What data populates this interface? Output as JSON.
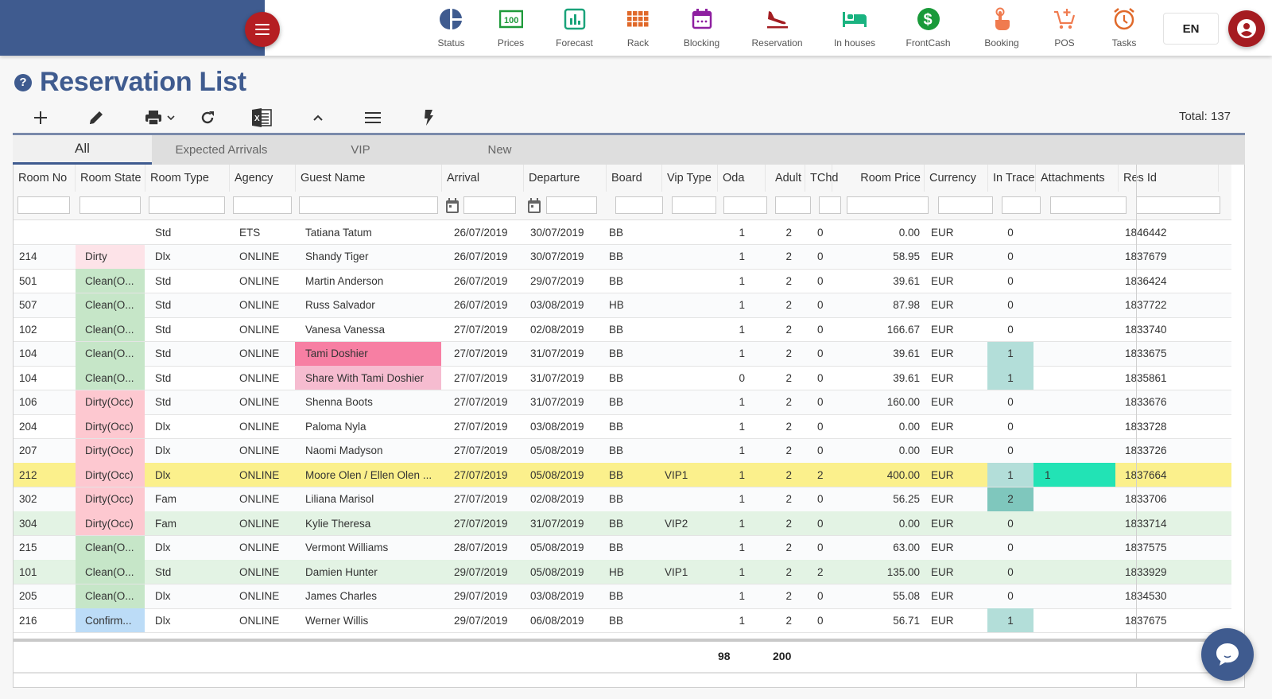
{
  "header": {
    "nav": [
      {
        "key": "status",
        "label": "Status",
        "icon": "pie-chart-icon",
        "color": "#3f5b8f"
      },
      {
        "key": "prices",
        "label": "Prices",
        "icon": "money-bill-icon",
        "color": "#1e9a3a"
      },
      {
        "key": "forecast",
        "label": "Forecast",
        "icon": "bar-chart-icon",
        "color": "#1aa37a"
      },
      {
        "key": "rack",
        "label": "Rack",
        "icon": "grid-icon",
        "color": "#e0692a"
      },
      {
        "key": "blocking",
        "label": "Blocking",
        "icon": "calendar-icon",
        "color": "#8e1fa0"
      },
      {
        "key": "reservation",
        "label": "Reservation",
        "icon": "plane-landing-icon",
        "color": "#a31d22"
      },
      {
        "key": "in_houses",
        "label": "In houses",
        "icon": "bed-icon",
        "color": "#1ab380"
      },
      {
        "key": "frontcash",
        "label": "FrontCash",
        "icon": "dollar-circle-icon",
        "color": "#1a9a3a"
      },
      {
        "key": "booking",
        "label": "Booking",
        "icon": "hand-pointer-icon",
        "color": "#f07b4f"
      },
      {
        "key": "pos",
        "label": "POS",
        "icon": "cart-plus-icon",
        "color": "#f07b4f"
      },
      {
        "key": "tasks",
        "label": "Tasks",
        "icon": "alarm-clock-icon",
        "color": "#e0692a"
      }
    ],
    "language": "EN",
    "brand_color": "#3f5b8f",
    "accent_color": "#b51e22"
  },
  "page": {
    "title": "Reservation List",
    "total_label": "Total: 137"
  },
  "toolbar": {
    "icons": [
      "add-icon",
      "edit-icon",
      "print-icon",
      "refresh-icon",
      "excel-export-icon",
      "collapse-icon",
      "menu-icon",
      "flash-icon"
    ]
  },
  "tabs": [
    {
      "label": "All",
      "active": true
    },
    {
      "label": "Expected Arrivals",
      "active": false
    },
    {
      "label": "VIP",
      "active": false
    },
    {
      "label": "New",
      "active": false
    }
  ],
  "columns": [
    "Room No",
    "Room State",
    "Room Type",
    "Agency",
    "Guest Name",
    "Arrival",
    "Departure",
    "Board",
    "Vip Type",
    "Oda",
    "Adult",
    "TChd",
    "Room Price",
    "Currency",
    "In Trace",
    "Attachments",
    "Res Id"
  ],
  "rows": [
    {
      "room": "",
      "state": "",
      "state_kind": "",
      "type": "Std",
      "agency": "ETS",
      "guest": "Tatiana Tatum",
      "guest_kind": "",
      "arrival": "26/07/2019",
      "departure": "30/07/2019",
      "board": "BB",
      "vip": "",
      "oda": "1",
      "adult": "2",
      "tchd": "0",
      "price": "0.00",
      "currency": "EUR",
      "trace": "0",
      "trace_kind": "",
      "attach": "",
      "resid": "1846442",
      "row_kind": ""
    },
    {
      "room": "214",
      "state": "Dirty",
      "state_kind": "dirty-light",
      "type": "Dlx",
      "agency": "ONLINE",
      "guest": "Shandy Tiger",
      "guest_kind": "",
      "arrival": "26/07/2019",
      "departure": "30/07/2019",
      "board": "BB",
      "vip": "",
      "oda": "1",
      "adult": "2",
      "tchd": "0",
      "price": "58.95",
      "currency": "EUR",
      "trace": "0",
      "trace_kind": "",
      "attach": "",
      "resid": "1837679",
      "row_kind": "alt"
    },
    {
      "room": "501",
      "state": "Clean(O...",
      "state_kind": "clean",
      "type": "Std",
      "agency": "ONLINE",
      "guest": "Martin Anderson",
      "guest_kind": "",
      "arrival": "26/07/2019",
      "departure": "29/07/2019",
      "board": "BB",
      "vip": "",
      "oda": "1",
      "adult": "2",
      "tchd": "0",
      "price": "39.61",
      "currency": "EUR",
      "trace": "0",
      "trace_kind": "",
      "attach": "",
      "resid": "1836424",
      "row_kind": ""
    },
    {
      "room": "507",
      "state": "Clean(O...",
      "state_kind": "clean",
      "type": "Std",
      "agency": "ONLINE",
      "guest": "Russ Salvador",
      "guest_kind": "",
      "arrival": "26/07/2019",
      "departure": "03/08/2019",
      "board": "HB",
      "vip": "",
      "oda": "1",
      "adult": "2",
      "tchd": "0",
      "price": "87.98",
      "currency": "EUR",
      "trace": "0",
      "trace_kind": "",
      "attach": "",
      "resid": "1837722",
      "row_kind": "alt"
    },
    {
      "room": "102",
      "state": "Clean(O...",
      "state_kind": "clean",
      "type": "Std",
      "agency": "ONLINE",
      "guest": "Vanesa Vanessa",
      "guest_kind": "",
      "arrival": "27/07/2019",
      "departure": "02/08/2019",
      "board": "BB",
      "vip": "",
      "oda": "1",
      "adult": "2",
      "tchd": "0",
      "price": "166.67",
      "currency": "EUR",
      "trace": "0",
      "trace_kind": "",
      "attach": "",
      "resid": "1833740",
      "row_kind": ""
    },
    {
      "room": "104",
      "state": "Clean(O...",
      "state_kind": "clean",
      "type": "Std",
      "agency": "ONLINE",
      "guest": "Tami Doshier",
      "guest_kind": "pink-strong",
      "arrival": "27/07/2019",
      "departure": "31/07/2019",
      "board": "BB",
      "vip": "",
      "oda": "1",
      "adult": "2",
      "tchd": "0",
      "price": "39.61",
      "currency": "EUR",
      "trace": "1",
      "trace_kind": "teal-light",
      "attach": "",
      "resid": "1833675",
      "row_kind": "alt"
    },
    {
      "room": "104",
      "state": "Clean(O...",
      "state_kind": "clean",
      "type": "Std",
      "agency": "ONLINE",
      "guest": "Share With Tami Doshier",
      "guest_kind": "pink-light",
      "arrival": "27/07/2019",
      "departure": "31/07/2019",
      "board": "BB",
      "vip": "",
      "oda": "0",
      "adult": "2",
      "tchd": "0",
      "price": "39.61",
      "currency": "EUR",
      "trace": "1",
      "trace_kind": "teal-light",
      "attach": "",
      "resid": "1835861",
      "row_kind": ""
    },
    {
      "room": "106",
      "state": "Dirty(Occ)",
      "state_kind": "dirty",
      "type": "Std",
      "agency": "ONLINE",
      "guest": "Shenna Boots",
      "guest_kind": "",
      "arrival": "27/07/2019",
      "departure": "31/07/2019",
      "board": "BB",
      "vip": "",
      "oda": "1",
      "adult": "2",
      "tchd": "0",
      "price": "160.00",
      "currency": "EUR",
      "trace": "0",
      "trace_kind": "",
      "attach": "",
      "resid": "1833676",
      "row_kind": "alt"
    },
    {
      "room": "204",
      "state": "Dirty(Occ)",
      "state_kind": "dirty",
      "type": "Dlx",
      "agency": "ONLINE",
      "guest": "Paloma Nyla",
      "guest_kind": "",
      "arrival": "27/07/2019",
      "departure": "03/08/2019",
      "board": "BB",
      "vip": "",
      "oda": "1",
      "adult": "2",
      "tchd": "0",
      "price": "0.00",
      "currency": "EUR",
      "trace": "0",
      "trace_kind": "",
      "attach": "",
      "resid": "1833728",
      "row_kind": ""
    },
    {
      "room": "207",
      "state": "Dirty(Occ)",
      "state_kind": "dirty",
      "type": "Dlx",
      "agency": "ONLINE",
      "guest": "Naomi Madyson",
      "guest_kind": "",
      "arrival": "27/07/2019",
      "departure": "05/08/2019",
      "board": "BB",
      "vip": "",
      "oda": "1",
      "adult": "2",
      "tchd": "0",
      "price": "0.00",
      "currency": "EUR",
      "trace": "0",
      "trace_kind": "",
      "attach": "",
      "resid": "1833726",
      "row_kind": "alt"
    },
    {
      "room": "212",
      "state": "Dirty(Occ)",
      "state_kind": "dirty",
      "type": "Dlx",
      "agency": "ONLINE",
      "guest": "Moore Olen / Ellen Olen ...",
      "guest_kind": "",
      "arrival": "27/07/2019",
      "departure": "05/08/2019",
      "board": "BB",
      "vip": "VIP1",
      "oda": "1",
      "adult": "2",
      "tchd": "2",
      "price": "400.00",
      "currency": "EUR",
      "trace": "1",
      "trace_kind": "teal-light",
      "attach": "1",
      "resid": "1837664",
      "row_kind": "yellow"
    },
    {
      "room": "302",
      "state": "Dirty(Occ)",
      "state_kind": "dirty",
      "type": "Fam",
      "agency": "ONLINE",
      "guest": "Liliana Marisol",
      "guest_kind": "",
      "arrival": "27/07/2019",
      "departure": "02/08/2019",
      "board": "BB",
      "vip": "",
      "oda": "1",
      "adult": "2",
      "tchd": "0",
      "price": "56.25",
      "currency": "EUR",
      "trace": "2",
      "trace_kind": "teal-dark",
      "attach": "",
      "resid": "1833706",
      "row_kind": "alt"
    },
    {
      "room": "304",
      "state": "Dirty(Occ)",
      "state_kind": "dirty",
      "type": "Fam",
      "agency": "ONLINE",
      "guest": "Kylie Theresa",
      "guest_kind": "",
      "arrival": "27/07/2019",
      "departure": "31/07/2019",
      "board": "BB",
      "vip": "VIP2",
      "oda": "1",
      "adult": "2",
      "tchd": "0",
      "price": "0.00",
      "currency": "EUR",
      "trace": "0",
      "trace_kind": "",
      "attach": "",
      "resid": "1833714",
      "row_kind": "green"
    },
    {
      "room": "215",
      "state": "Clean(O...",
      "state_kind": "clean",
      "type": "Dlx",
      "agency": "ONLINE",
      "guest": "Vermont Williams",
      "guest_kind": "",
      "arrival": "28/07/2019",
      "departure": "05/08/2019",
      "board": "BB",
      "vip": "",
      "oda": "1",
      "adult": "2",
      "tchd": "0",
      "price": "63.00",
      "currency": "EUR",
      "trace": "0",
      "trace_kind": "",
      "attach": "",
      "resid": "1837575",
      "row_kind": "alt"
    },
    {
      "room": "101",
      "state": "Clean(O...",
      "state_kind": "clean",
      "type": "Std",
      "agency": "ONLINE",
      "guest": "Damien Hunter",
      "guest_kind": "",
      "arrival": "29/07/2019",
      "departure": "05/08/2019",
      "board": "HB",
      "vip": "VIP1",
      "oda": "1",
      "adult": "2",
      "tchd": "2",
      "price": "135.00",
      "currency": "EUR",
      "trace": "0",
      "trace_kind": "",
      "attach": "",
      "resid": "1833929",
      "row_kind": "green"
    },
    {
      "room": "205",
      "state": "Clean(O...",
      "state_kind": "clean",
      "type": "Dlx",
      "agency": "ONLINE",
      "guest": "James Charles",
      "guest_kind": "",
      "arrival": "29/07/2019",
      "departure": "03/08/2019",
      "board": "BB",
      "vip": "",
      "oda": "1",
      "adult": "2",
      "tchd": "0",
      "price": "55.08",
      "currency": "EUR",
      "trace": "0",
      "trace_kind": "",
      "attach": "",
      "resid": "1834530",
      "row_kind": "alt"
    },
    {
      "room": "216",
      "state": "Confirm...",
      "state_kind": "confirm",
      "type": "Dlx",
      "agency": "ONLINE",
      "guest": "Werner Willis",
      "guest_kind": "",
      "arrival": "29/07/2019",
      "departure": "06/08/2019",
      "board": "BB",
      "vip": "",
      "oda": "1",
      "adult": "2",
      "tchd": "0",
      "price": "56.71",
      "currency": "EUR",
      "trace": "1",
      "trace_kind": "teal-light",
      "attach": "",
      "resid": "1837675",
      "row_kind": ""
    }
  ],
  "footer": {
    "oda_total": "98",
    "adult_total": "200"
  },
  "cell_colors": {
    "dirty-light": "#fde3e8",
    "dirty": "#fdc8d0",
    "clean": "#c6e6c8",
    "confirm": "#bcdcf7",
    "pink-strong": "#f77fa3",
    "pink-light": "#f6bcd0",
    "teal-light": "#b3ded9",
    "teal-dark": "#7fc7bd",
    "attach-green": "#22e3b5"
  }
}
